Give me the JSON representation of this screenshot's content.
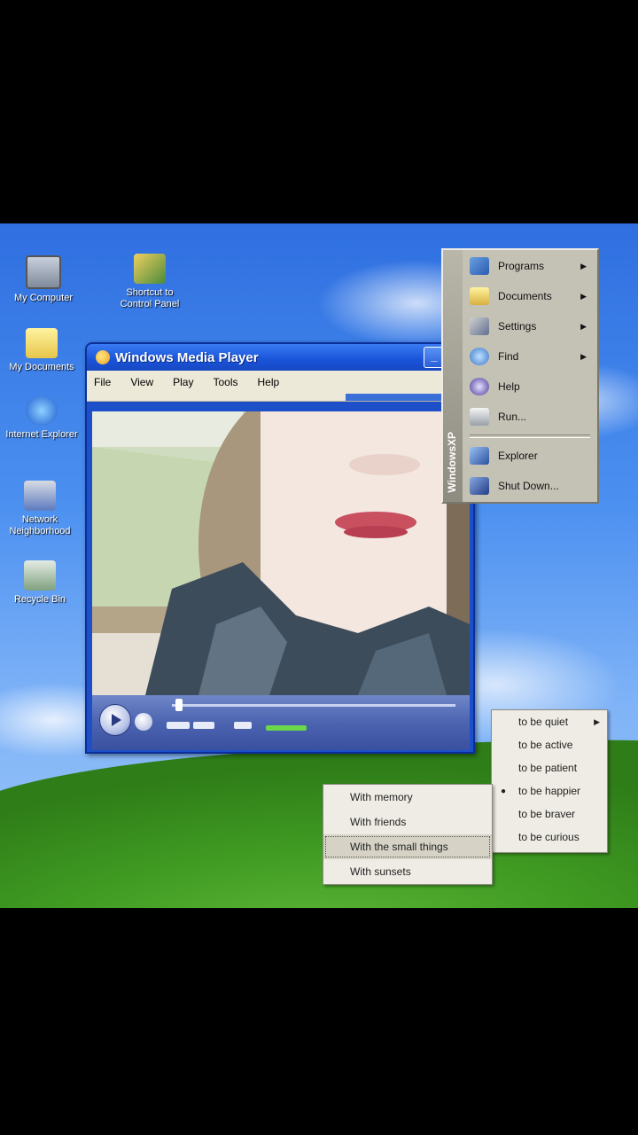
{
  "desktop": {
    "icons": [
      {
        "label": "My Computer",
        "icon": "computer-icon"
      },
      {
        "label": "Shortcut to Control Panel",
        "icon": "control-panel-icon"
      },
      {
        "label": "My Documents",
        "icon": "folder-icon"
      },
      {
        "label": "Internet Explorer",
        "icon": "internet-explorer-icon"
      },
      {
        "label": "Network Neighborhood",
        "icon": "network-icon"
      },
      {
        "label": "Recycle Bin",
        "icon": "recycle-bin-icon"
      }
    ]
  },
  "wmp": {
    "title": "Windows Media Player",
    "menu": [
      "File",
      "View",
      "Play",
      "Tools",
      "Help"
    ],
    "controls": {
      "play_icon": "play-icon",
      "stop_icon": "stop-icon"
    }
  },
  "start_menu": {
    "stripe": "WindowsXP",
    "items": [
      {
        "label": "Programs",
        "icon": "programs-icon",
        "submenu": true
      },
      {
        "label": "Documents",
        "icon": "documents-icon",
        "submenu": true
      },
      {
        "label": "Settings",
        "icon": "settings-icon",
        "submenu": true
      },
      {
        "label": "Find",
        "icon": "find-icon",
        "submenu": true
      },
      {
        "label": "Help",
        "icon": "help-icon",
        "submenu": false
      },
      {
        "label": "Run...",
        "icon": "run-icon",
        "submenu": false
      },
      {
        "label": "Explorer",
        "icon": "explorer-icon",
        "submenu": false
      },
      {
        "label": "Shut Down...",
        "icon": "shutdown-icon",
        "submenu": false
      }
    ]
  },
  "feelings_menu": {
    "items": [
      {
        "label": "to be quiet",
        "checked": false,
        "submenu": true
      },
      {
        "label": "to be active",
        "checked": false,
        "submenu": false
      },
      {
        "label": "to be patient",
        "checked": false,
        "submenu": false
      },
      {
        "label": "to be happier",
        "checked": true,
        "submenu": false
      },
      {
        "label": "to be braver",
        "checked": false,
        "submenu": false
      },
      {
        "label": "to be curious",
        "checked": false,
        "submenu": false
      }
    ]
  },
  "with_menu": {
    "items": [
      {
        "label": "With memory",
        "selected": false
      },
      {
        "label": "With friends",
        "selected": false
      },
      {
        "label": "With the small things",
        "selected": true
      },
      {
        "label": "With sunsets",
        "selected": false
      }
    ]
  }
}
